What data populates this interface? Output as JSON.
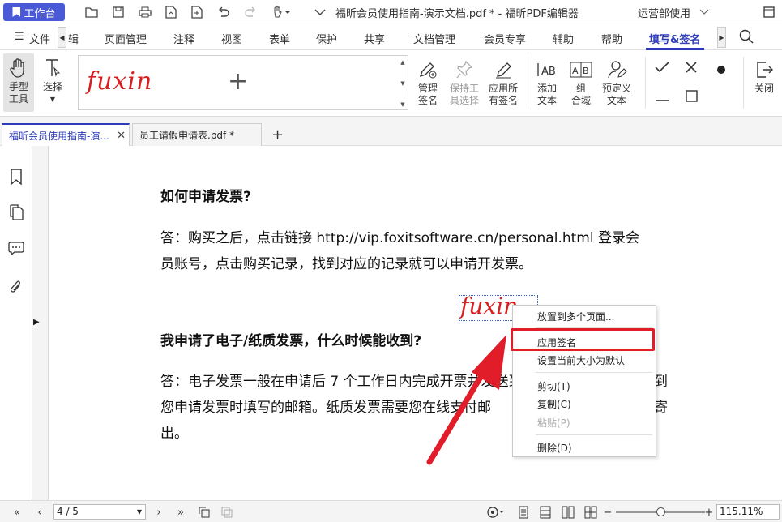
{
  "titlebar": {
    "workbench_label": "工作台",
    "doc_title": "福昕会员使用指南-演示文档.pdf * - 福昕PDF编辑器",
    "dept_label": "运营部使用"
  },
  "menubar": {
    "file_label": "文件",
    "items": [
      "辑",
      "页面管理",
      "注释",
      "视图",
      "表单",
      "保护",
      "共享",
      "文档管理",
      "会员专享",
      "辅助",
      "帮助",
      "填写&签名"
    ]
  },
  "ribbon": {
    "hand_tool": "手型\n工具",
    "select_tool": "选择",
    "signature_text": "fuxin",
    "add_symbol": "+",
    "manage_sig": "管理\n签名",
    "keep_tool": "保持工\n具选择",
    "apply_all": "应用所\n有签名",
    "add_text": "添加\n文本",
    "comb_field": "组\n合域",
    "preset_text": "预定义\n文本",
    "close": "关闭"
  },
  "tabs": [
    {
      "label": "福昕会员使用指南-演...",
      "active": true
    },
    {
      "label": "员工请假申请表.pdf *",
      "active": false
    }
  ],
  "document": {
    "q1": "如何申请发票?",
    "a1_line1": "答：购买之后，点击链接 http://vip.foxitsoftware.cn/personal.html 登录会",
    "a1_line2": "员账号，点击购买记录，找到对应的记录就可以申请开发票。",
    "q2": "我申请了电子/纸质发票，什么时候能收到?",
    "a2_line1": "答：电子发票一般在申请后 7 个工作日内完成开票并发送到",
    "a2_line1_end": "到",
    "a2_line2": "您申请发票时填写的邮箱。纸质发票需要您在线支付邮",
    "a2_line2_end": "寄",
    "a2_line3": "出。",
    "placed_signature": "fuxin"
  },
  "context_menu": {
    "items": [
      {
        "label": "放置到多个页面...",
        "disabled": false
      },
      {
        "label": "应用签名",
        "disabled": false
      },
      {
        "label": "设置当前大小为默认",
        "disabled": false
      },
      {
        "label": "剪切(T)",
        "disabled": false
      },
      {
        "label": "复制(C)",
        "disabled": false
      },
      {
        "label": "粘贴(P)",
        "disabled": true
      },
      {
        "label": "删除(D)",
        "disabled": false
      }
    ]
  },
  "statusbar": {
    "page_indicator": "4 / 5",
    "zoom": "115.11%"
  },
  "colors": {
    "accent": "#2d3bb8",
    "signature_red": "#d81e1e",
    "highlight_red": "#e11d2a"
  }
}
